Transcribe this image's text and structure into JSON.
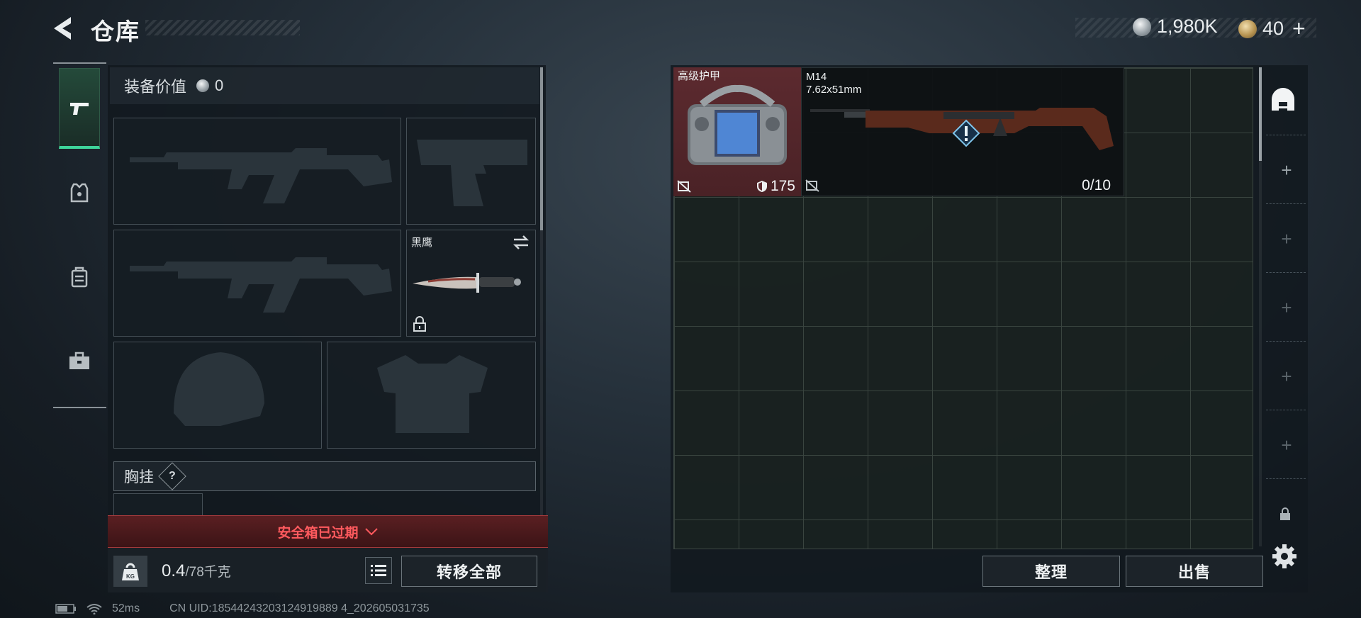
{
  "header": {
    "title": "仓库"
  },
  "currency": [
    {
      "icon": "silver-coin-icon",
      "amount": "1,980K"
    },
    {
      "icon": "gold-coin-icon",
      "amount": "40",
      "suffix": "+"
    }
  ],
  "loadout": {
    "equipment_value_label": "装备价值",
    "equipment_value": "0",
    "knife_name": "黑鹰",
    "chest_rig_label": "胸挂",
    "chest_rig_help": "?",
    "safebox_status": "安全箱已过期",
    "weight_current": "0.4",
    "weight_max": "/78千克",
    "transfer_all_label": "转移全部"
  },
  "storage": {
    "items": [
      {
        "name": "高级护甲",
        "value": "175"
      },
      {
        "name": "M14",
        "caliber": "7.62x51mm",
        "value": "0/10"
      }
    ],
    "sort_label": "整理",
    "sell_label": "出售"
  },
  "status_bar": {
    "ping": "52ms",
    "uid": "CN UID:18544243203124919889 4_202605031735"
  },
  "colors": {
    "accent_green": "#3ed49a",
    "armor_bg": "#5c2a2f",
    "alert_red": "#ff5a5e"
  }
}
